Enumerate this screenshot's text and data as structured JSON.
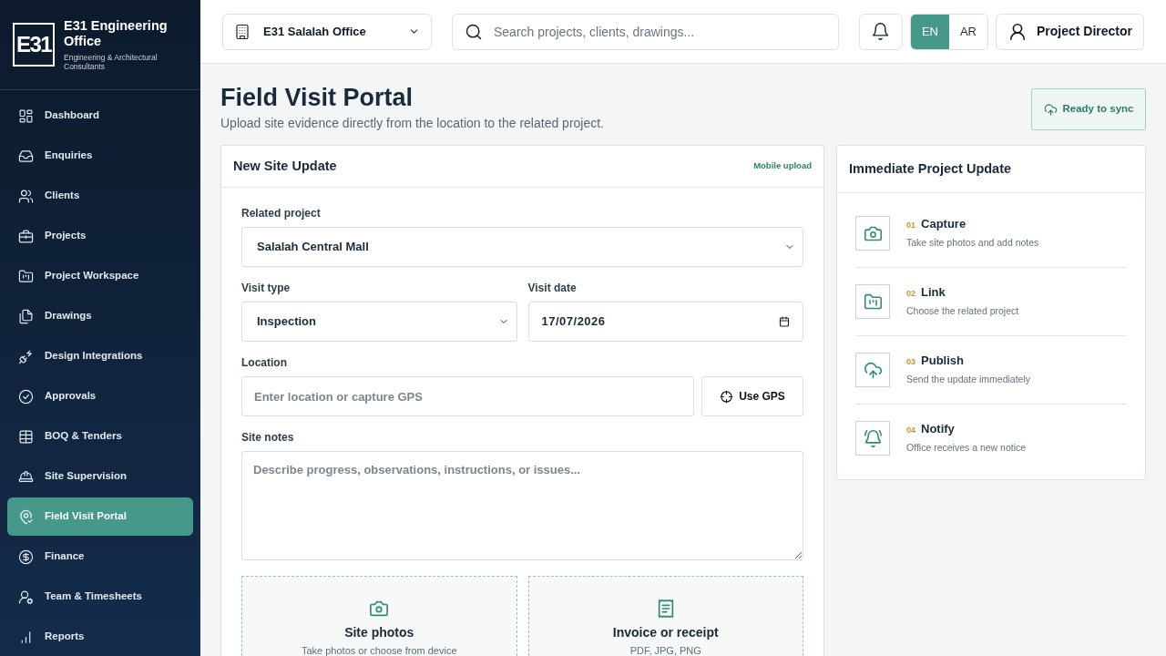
{
  "brand": {
    "logo": "E31",
    "name": "E31 Engineering Office",
    "tagline": "Engineering & Architectural Consultants"
  },
  "sidebar": {
    "items": [
      {
        "label": "Dashboard",
        "selected": false
      },
      {
        "label": "Enquiries",
        "selected": false
      },
      {
        "label": "Clients",
        "selected": false
      },
      {
        "label": "Projects",
        "selected": false
      },
      {
        "label": "Project Workspace",
        "selected": false
      },
      {
        "label": "Drawings",
        "selected": false
      },
      {
        "label": "Design Integrations",
        "selected": false
      },
      {
        "label": "Approvals",
        "selected": false
      },
      {
        "label": "BOQ & Tenders",
        "selected": false
      },
      {
        "label": "Site Supervision",
        "selected": false
      },
      {
        "label": "Field Visit Portal",
        "selected": true
      },
      {
        "label": "Finance",
        "selected": false
      },
      {
        "label": "Team & Timesheets",
        "selected": false
      },
      {
        "label": "Reports",
        "selected": false
      }
    ]
  },
  "topbar": {
    "office_selector": {
      "value": "E31 Salalah Office"
    },
    "search": {
      "placeholder": "Search projects, clients, drawings..."
    },
    "languages": [
      {
        "label": "EN",
        "selected": true
      },
      {
        "label": "AR",
        "selected": false
      }
    ],
    "user": {
      "label": "Project Director"
    }
  },
  "page": {
    "title": "Field Visit Portal",
    "subtitle": "Upload site evidence directly from the location to the related project.",
    "sync_button": {
      "label": "Ready to sync"
    }
  },
  "site_update_form": {
    "title": "New Site Update",
    "badge": "Mobile upload",
    "related_project": {
      "label": "Related project",
      "value": "Salalah Central Mall"
    },
    "visit_type": {
      "label": "Visit type",
      "value": "Inspection"
    },
    "visit_date": {
      "label": "Visit date",
      "value": "17/07/2026"
    },
    "location": {
      "label": "Location",
      "placeholder": "Enter location or capture GPS",
      "button": "Use GPS"
    },
    "site_notes": {
      "label": "Site notes",
      "placeholder": "Describe progress, observations, instructions, or issues..."
    },
    "uploads": [
      {
        "title": "Site photos",
        "hint": "Take photos or choose from device"
      },
      {
        "title": "Invoice or receipt",
        "hint": "PDF, JPG, PNG"
      }
    ]
  },
  "update_steps": {
    "title": "Immediate Project Update",
    "steps": [
      {
        "number": "01",
        "title": "Capture",
        "description": "Take site photos and add notes"
      },
      {
        "number": "02",
        "title": "Link",
        "description": "Choose the related project"
      },
      {
        "number": "03",
        "title": "Publish",
        "description": "Send the update immediately"
      },
      {
        "number": "04",
        "title": "Notify",
        "description": "Office receives a new notice"
      }
    ]
  }
}
